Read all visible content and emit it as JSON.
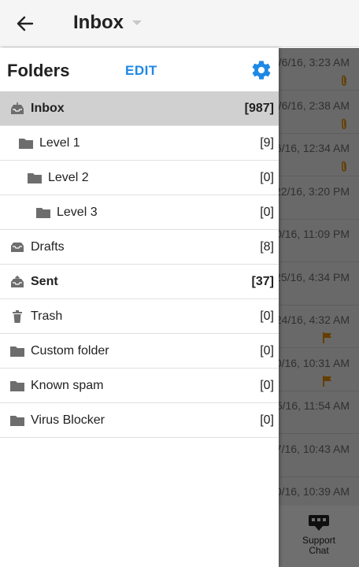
{
  "appbar": {
    "title": "Inbox"
  },
  "drawer": {
    "title": "Folders",
    "edit_label": "EDIT",
    "folders": [
      {
        "name": "Inbox",
        "count": "[987]",
        "icon": "inbox-icon",
        "bold": true,
        "selected": true,
        "indent": 0
      },
      {
        "name": "Level 1",
        "count": "[9]",
        "icon": "folder-icon",
        "bold": false,
        "selected": false,
        "indent": 1
      },
      {
        "name": "Level 2",
        "count": "[0]",
        "icon": "folder-icon",
        "bold": false,
        "selected": false,
        "indent": 2
      },
      {
        "name": "Level 3",
        "count": "[0]",
        "icon": "folder-icon",
        "bold": false,
        "selected": false,
        "indent": 3
      },
      {
        "name": "Drafts",
        "count": "[8]",
        "icon": "drafts-icon",
        "bold": false,
        "selected": false,
        "indent": 0
      },
      {
        "name": "Sent",
        "count": "[37]",
        "icon": "sent-icon",
        "bold": true,
        "selected": false,
        "indent": 0
      },
      {
        "name": "Trash",
        "count": "[0]",
        "icon": "trash-icon",
        "bold": false,
        "selected": false,
        "indent": 0
      },
      {
        "name": "Custom folder",
        "count": "[0]",
        "icon": "folder-icon",
        "bold": false,
        "selected": false,
        "indent": 0
      },
      {
        "name": "Known spam",
        "count": "[0]",
        "icon": "folder-icon",
        "bold": false,
        "selected": false,
        "indent": 0
      },
      {
        "name": "Virus Blocker",
        "count": "[0]",
        "icon": "folder-icon",
        "bold": false,
        "selected": false,
        "indent": 0
      }
    ]
  },
  "mail_list": [
    {
      "date": "/6/16, 3:23 AM",
      "mark": "paperclip-icon"
    },
    {
      "date": "/6/16, 2:38 AM",
      "mark": "paperclip-icon"
    },
    {
      "date": "6/16, 12:34 AM",
      "mark": "paperclip-icon"
    },
    {
      "date": "22/16, 3:20 PM",
      "mark": ""
    },
    {
      "date": "0/16, 11:09 PM",
      "mark": ""
    },
    {
      "date": "25/16, 4:34 PM",
      "mark": ""
    },
    {
      "date": "24/16, 4:32 AM",
      "mark": "flag-icon"
    },
    {
      "date": "0/16, 10:31 AM",
      "mark": "flag-icon"
    },
    {
      "date": "5/16, 11:54 AM",
      "mark": ""
    },
    {
      "date": "7/16, 10:43 AM",
      "mark": ""
    },
    {
      "date": "0/16, 10:39 AM",
      "mark": ""
    }
  ],
  "support": {
    "label": "Support Chat"
  },
  "colors": {
    "accent": "#1e88e5",
    "selected_row": "#d0d0d0",
    "mark": "#e08a00",
    "icon": "#6d6d6d"
  }
}
